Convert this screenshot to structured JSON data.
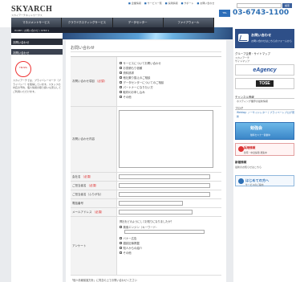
{
  "header": {
    "logo": "SKYARCH",
    "logo_sub": "スカイアーチネットワークス",
    "top_links": [
      "企業情報",
      "サービス一覧",
      "採用情報",
      "サポート",
      "お問い合わせ"
    ],
    "search_button": "検索",
    "phone_badge": "TEL",
    "phone": "03-6743-1100"
  },
  "nav": {
    "items": [
      "マネジメントサービス",
      "クラウドホスティングサービス",
      "データセンター",
      "ファイアウォール"
    ]
  },
  "breadcrumb": "HOME / お問い合わせ / STEP 1",
  "sidebar": {
    "title": "お問い合わせ",
    "item": "お問い合わせ",
    "badge": "TRUSTe",
    "note": "スカイアーチでは、プライバシーマーク（プライバシー）を取得しています。スタッフの対応の予約、個人情報の取り扱いも安心してご利用いただけます。"
  },
  "main": {
    "page_title": "お問い合わせ",
    "form": {
      "inquiry_label": "お問い合わせ項目",
      "required": "（必須）",
      "inquiry_options": [
        "サービスについてお問い合わせ",
        "お見積もり依頼",
        "資料請求",
        "他社乗り換えのご相談",
        "データセンターについてのご相談",
        "パートナーになりたい方",
        "取材のお申し込み",
        "その他"
      ],
      "content_label": "お問い合わせ内容",
      "company_label": "会社名",
      "company_req": "（必須）",
      "name_label": "ご担当者名",
      "name_req": "（必須）",
      "kana_label": "ご担当者名（ふりがな）",
      "phone_label": "電話番号",
      "email_label": "メールアドレス",
      "email_req": "（必須）",
      "survey_label": "アンケート",
      "survey_question": "弊社をどのようにしてお知りになりましたか？",
      "survey_options": [
        "検索エンジン（キーワード：",
        "バナー広告",
        "雑誌記事掲載",
        "知人からの紹介",
        "その他"
      ]
    },
    "footer_note": "「個人情報保護方針」に同意の上でお問い合わせください"
  },
  "right": {
    "contact_title": "お問い合わせ",
    "contact_sub": "お問い合わせはこちらのフォームから",
    "group_title": "グループ企業・サイトマップ",
    "group_links": [
      "スカイアーチ",
      "サイトマップ"
    ],
    "agency_logo": "eAgency",
    "tose_logo": "TOSE",
    "channel_title": "チャンネル情報",
    "channel_text": "ホスティング業界の最新情報",
    "blog_title": "ブログ",
    "blog_link": "Weblog: ノーサイドレター / プライベートブログ更新",
    "study_title": "勉強会",
    "study_sub": "無料セミナー開催中",
    "recruit_title": "採用情報",
    "recruit_sub": "新卒・中途採用 募集中",
    "news_title": "新着情報",
    "news_sub": "最新のお知らせはこちら",
    "firsttime_title": "はじめての方へ",
    "firsttime_sub": "サービスのご案内"
  },
  "colors": {
    "accent": "#2d6fb4",
    "required": "#dd2222",
    "nav_dark": "#343c48"
  }
}
